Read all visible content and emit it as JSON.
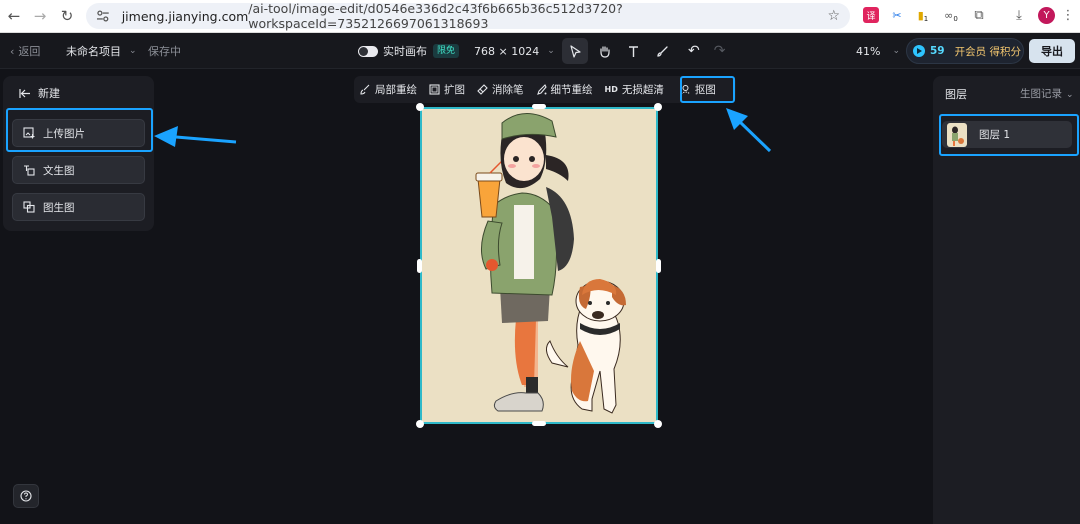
{
  "browser": {
    "url_host": "jimeng.jianying.com",
    "url_path": "/ai-tool/image-edit/d0546e336d2c43f6b665b36c512d3720?workspaceId=7352126697061318693",
    "avatar_letter": "Y",
    "ext_badge_1": "1",
    "ext_badge_2": "0"
  },
  "topbar": {
    "back_label": "返回",
    "project_name": "未命名项目",
    "save_status": "保存中",
    "realtime_label": "实时画布",
    "free_badge": "限免",
    "canvas_size": "768 × 1024",
    "zoom": "41%",
    "credits": "59",
    "vip_label": "开会员 得积分",
    "export_label": "导出"
  },
  "left_panel": {
    "title": "新建",
    "buttons": [
      {
        "label": "上传图片"
      },
      {
        "label": "文生图"
      },
      {
        "label": "图生图"
      }
    ]
  },
  "floating_toolbar": {
    "items": [
      {
        "label": "局部重绘"
      },
      {
        "label": "扩图"
      },
      {
        "label": "消除笔"
      },
      {
        "label": "细节重绘"
      },
      {
        "label": "无损超清",
        "prefix": "HD"
      },
      {
        "label": "抠图"
      }
    ]
  },
  "right_panel": {
    "title": "图层",
    "history_label": "生图记录",
    "layers": [
      {
        "name": "图层 1"
      }
    ]
  },
  "colors": {
    "accent_highlight": "#1aa3ff",
    "canvas_border": "#2fb9c9",
    "canvas_bg": "#ebe0c4",
    "background": "#121318"
  }
}
